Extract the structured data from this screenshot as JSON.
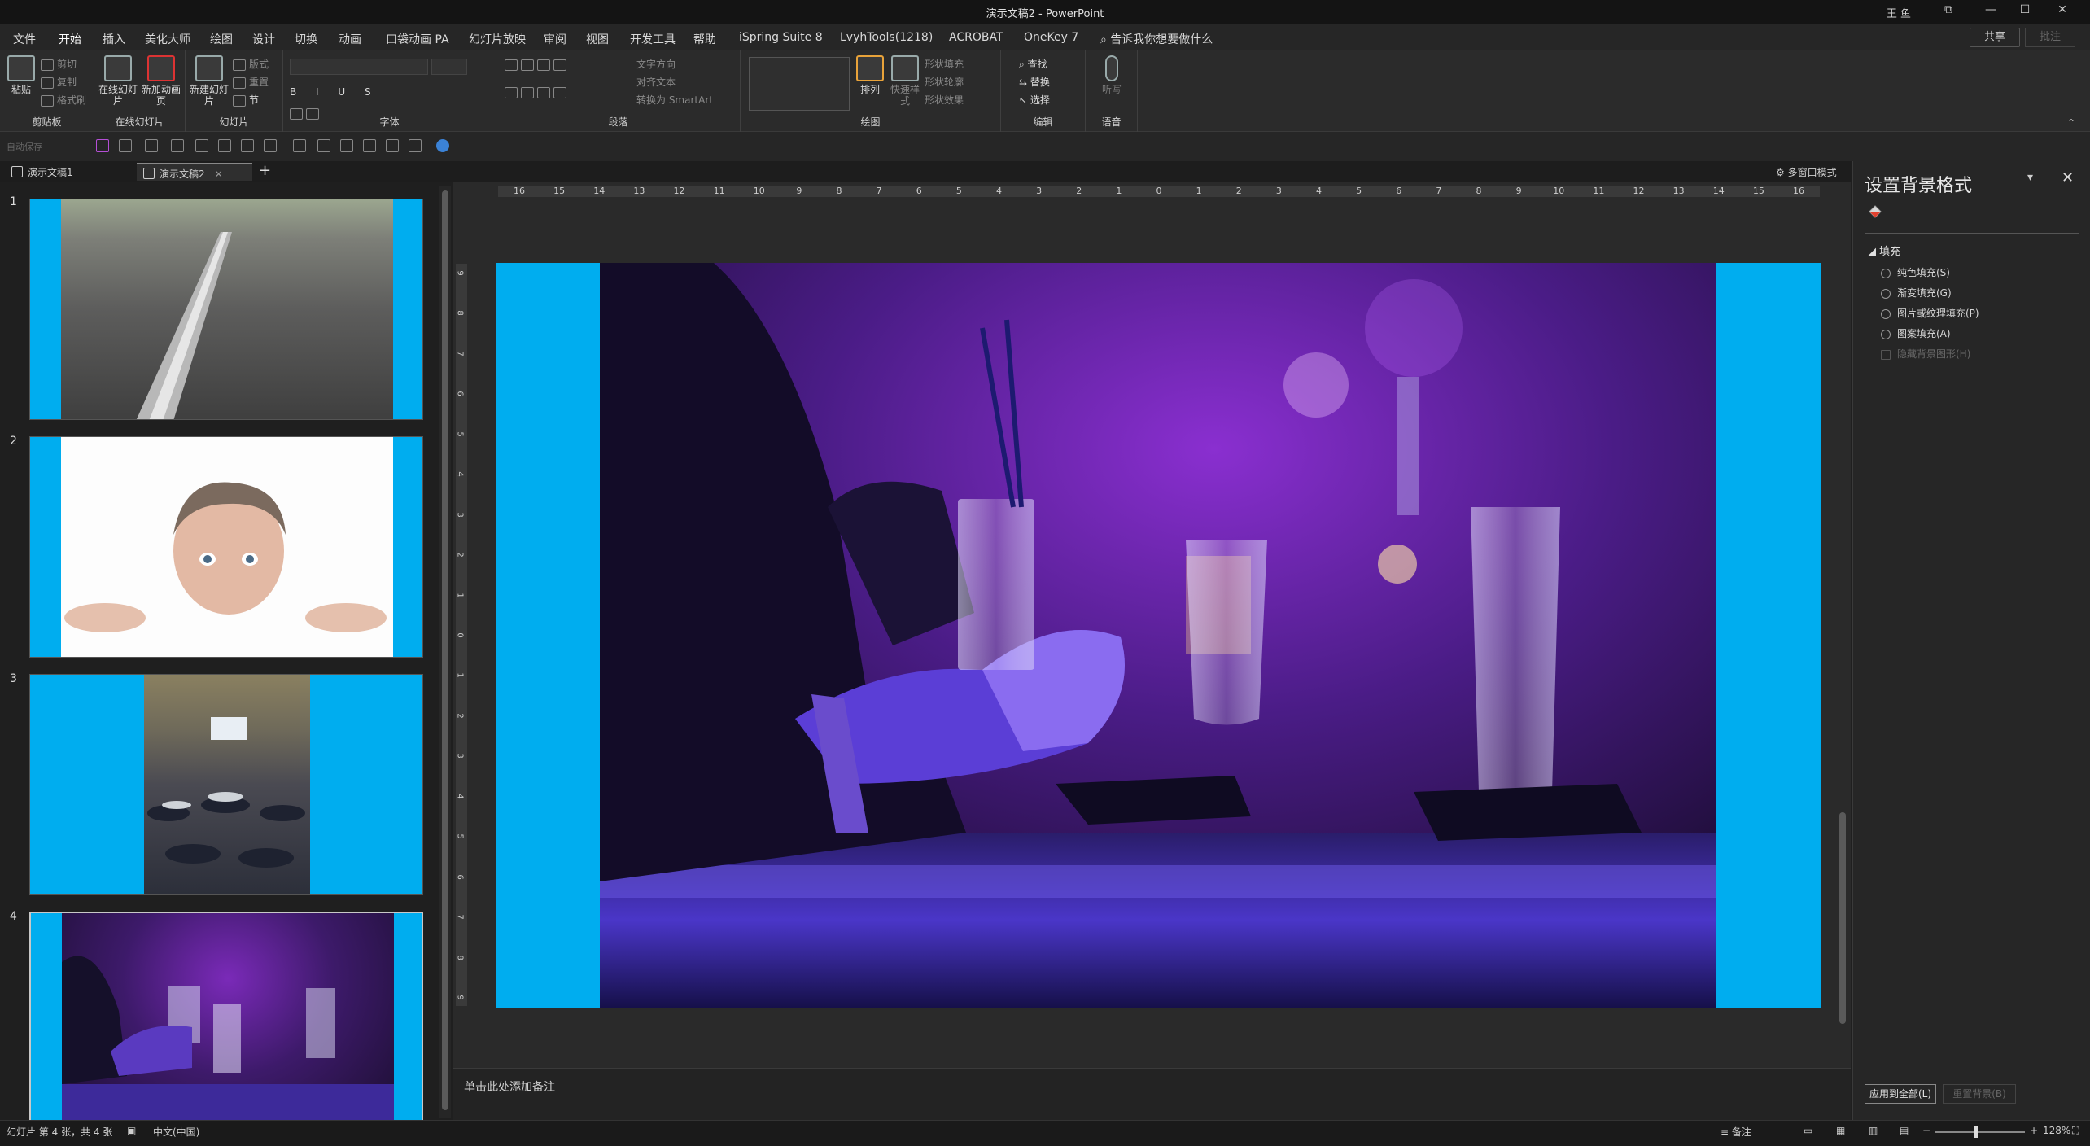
{
  "window": {
    "title": "演示文稿2  -  PowerPoint",
    "user": "王 鱼",
    "controls": [
      "⧉",
      "—",
      "☐",
      "✕"
    ]
  },
  "tabs": [
    "文件",
    "开始",
    "插入",
    "美化大师",
    "绘图",
    "设计",
    "切换",
    "动画",
    "口袋动画 PA",
    "幻灯片放映",
    "审阅",
    "视图",
    "开发工具",
    "帮助",
    "iSpring Suite 8",
    "LvyhTools(1218)",
    "ACROBAT",
    "OneKey 7"
  ],
  "active_tab": "开始",
  "tell_me": "告诉我你想要做什么",
  "share_label": "共享",
  "comment_label": "批注",
  "ribbon": {
    "clipboard": {
      "name": "剪贴板",
      "paste": "粘贴",
      "cut": "剪切",
      "copy": "复制",
      "format": "格式刷"
    },
    "online_slides": {
      "name": "在线幻灯片",
      "online": "在线幻灯片",
      "new_anim": "新加动画页"
    },
    "slides": {
      "name": "幻灯片",
      "new_slide": "新建幻灯片",
      "layout": "版式",
      "reset": "重置",
      "section": "节"
    },
    "font": {
      "name": "字体"
    },
    "paragraph": {
      "name": "段落",
      "text_direction": "文字方向",
      "align_text": "对齐文本",
      "smartart": "转换为 SmartArt"
    },
    "drawing": {
      "name": "绘图",
      "arrange": "排列",
      "quick_styles": "快速样式",
      "shape_fill": "形状填充",
      "shape_outline": "形状轮廓",
      "shape_effects": "形状效果"
    },
    "editing": {
      "name": "编辑",
      "find": "查找",
      "replace": "替换",
      "select": "选择"
    },
    "voice": {
      "name": "语音",
      "dictate": "听写"
    }
  },
  "qat": {
    "autosave": "自动保存"
  },
  "doc_tabs": [
    {
      "label": "演示文稿1",
      "active": false
    },
    {
      "label": "演示文稿2",
      "active": true
    }
  ],
  "multi_window": "多窗口模式",
  "thumbnails": [
    {
      "number": "1",
      "content": "railway-track-photo"
    },
    {
      "number": "2",
      "content": "man-peeking-photo"
    },
    {
      "number": "3",
      "content": "conference-hall-photo"
    },
    {
      "number": "4",
      "content": "bar-drinks-photo"
    }
  ],
  "selected_slide": 4,
  "ruler": {
    "h_labels": [
      "16",
      "15",
      "14",
      "13",
      "12",
      "11",
      "10",
      "9",
      "8",
      "7",
      "6",
      "5",
      "4",
      "3",
      "2",
      "1",
      "0",
      "1",
      "2",
      "3",
      "4",
      "5",
      "6",
      "7",
      "8",
      "9",
      "10",
      "11",
      "12",
      "13",
      "14",
      "15",
      "16"
    ],
    "v_labels": [
      "9",
      "8",
      "7",
      "6",
      "5",
      "4",
      "3",
      "2",
      "1",
      "0",
      "1",
      "2",
      "3",
      "4",
      "5",
      "6",
      "7",
      "8",
      "9"
    ]
  },
  "notes_placeholder": "单击此处添加备注",
  "format_pane": {
    "title": "设置背景格式",
    "section": "填充",
    "options": [
      {
        "label": "纯色填充(S)",
        "enabled": true
      },
      {
        "label": "渐变填充(G)",
        "enabled": true
      },
      {
        "label": "图片或纹理填充(P)",
        "enabled": true
      },
      {
        "label": "图案填充(A)",
        "enabled": true
      },
      {
        "label": "隐藏背景图形(H)",
        "enabled": false
      }
    ],
    "apply_all": "应用到全部(L)",
    "reset": "重置背景(B)"
  },
  "status": {
    "slide_info": "幻灯片 第 4 张，共 4 张",
    "language": "中文(中国)",
    "notes": "备注",
    "zoom": "128%"
  },
  "colors": {
    "slide_background": "#00adef",
    "app_dark": "#1f1f1f"
  }
}
